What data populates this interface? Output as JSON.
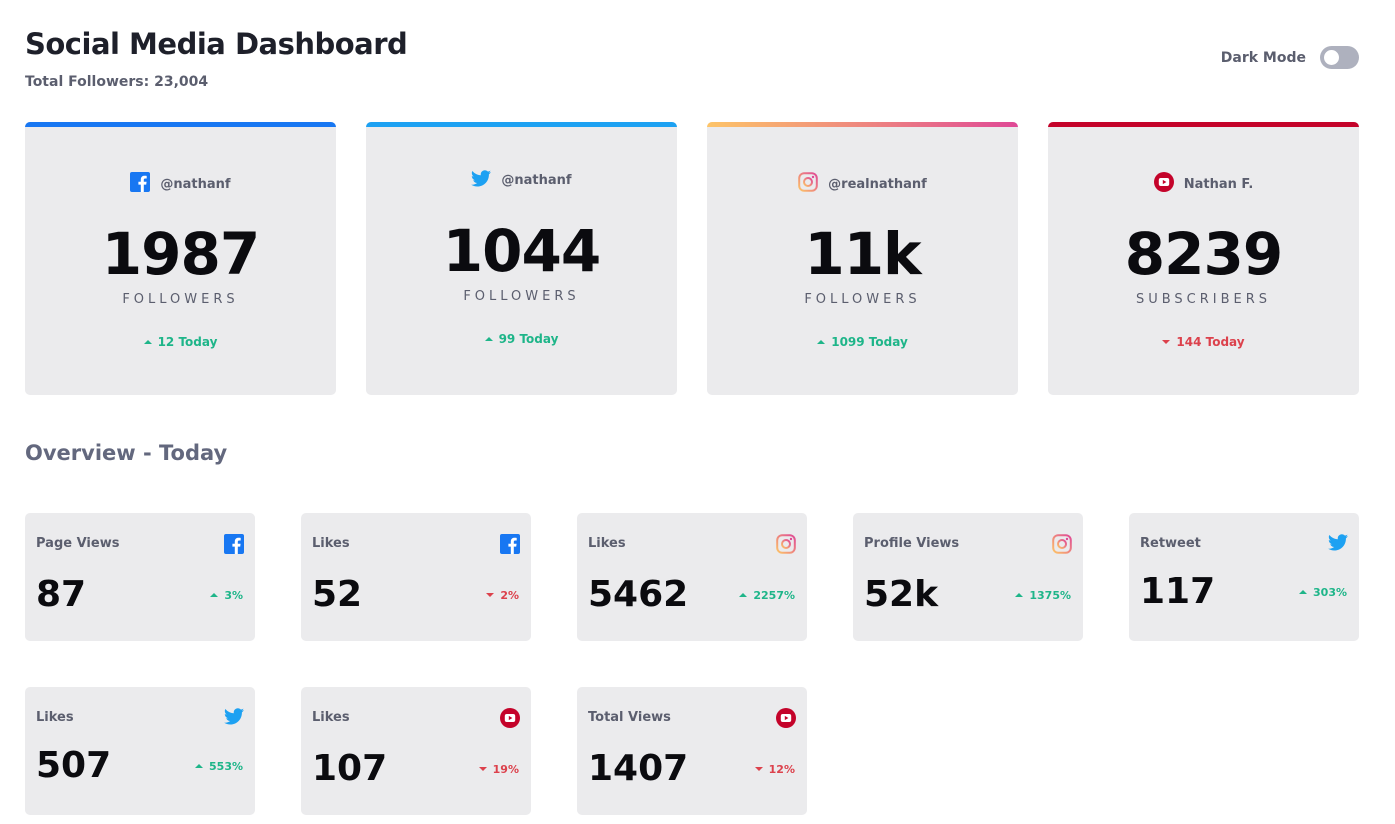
{
  "header": {
    "title": "Social Media Dashboard",
    "total_followers": "Total Followers: 23,004",
    "dark_mode_label": "Dark Mode",
    "dark_mode_on": false
  },
  "colors": {
    "facebook": "#1877f2",
    "twitter": "#1da1f2",
    "instagram_start": "#fdc468",
    "instagram_end": "#df4996",
    "youtube": "#c4032a",
    "up": "#1eb589",
    "down": "#dc414c"
  },
  "follower_cards": [
    {
      "platform": "facebook",
      "icon": "facebook-icon",
      "handle": "@nathanf",
      "count": "1987",
      "unit": "FOLLOWERS",
      "change": "12 Today",
      "direction": "up"
    },
    {
      "platform": "twitter",
      "icon": "twitter-icon",
      "handle": "@nathanf",
      "count": "1044",
      "unit": "FOLLOWERS",
      "change": "99 Today",
      "direction": "up"
    },
    {
      "platform": "instagram",
      "icon": "instagram-icon",
      "handle": "@realnathanf",
      "count": "11k",
      "unit": "FOLLOWERS",
      "change": "1099 Today",
      "direction": "up"
    },
    {
      "platform": "youtube",
      "icon": "youtube-icon",
      "handle": "Nathan F.",
      "count": "8239",
      "unit": "SUBSCRIBERS",
      "change": "144 Today",
      "direction": "down"
    }
  ],
  "overview": {
    "title": "Overview - Today",
    "cards": [
      {
        "metric": "Page Views",
        "platform": "facebook",
        "icon": "facebook-icon",
        "value": "87",
        "change": "3%",
        "direction": "up"
      },
      {
        "metric": "Likes",
        "platform": "facebook",
        "icon": "facebook-icon",
        "value": "52",
        "change": "2%",
        "direction": "down"
      },
      {
        "metric": "Likes",
        "platform": "instagram",
        "icon": "instagram-icon",
        "value": "5462",
        "change": "2257%",
        "direction": "up"
      },
      {
        "metric": "Profile Views",
        "platform": "instagram",
        "icon": "instagram-icon",
        "value": "52k",
        "change": "1375%",
        "direction": "up"
      },
      {
        "metric": "Retweet",
        "platform": "twitter",
        "icon": "twitter-icon",
        "value": "117",
        "change": "303%",
        "direction": "up"
      },
      {
        "metric": "Likes",
        "platform": "twitter",
        "icon": "twitter-icon",
        "value": "507",
        "change": "553%",
        "direction": "up"
      },
      {
        "metric": "Likes",
        "platform": "youtube",
        "icon": "youtube-icon",
        "value": "107",
        "change": "19%",
        "direction": "down"
      },
      {
        "metric": "Total Views",
        "platform": "youtube",
        "icon": "youtube-icon",
        "value": "1407",
        "change": "12%",
        "direction": "down"
      }
    ]
  }
}
